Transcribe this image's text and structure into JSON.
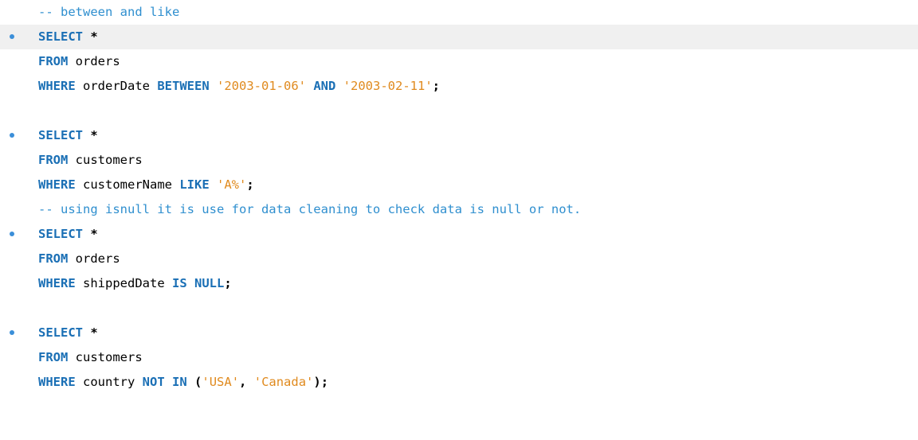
{
  "editor": {
    "language": "SQL",
    "colors": {
      "keyword": "#1a6fb5",
      "string": "#e08a1e",
      "comment": "#2f8fcf",
      "bullet": "#3b8fd9",
      "highlight": "#f0f0f0"
    },
    "lines": [
      {
        "bullet": false,
        "highlight": false,
        "tokens": [
          {
            "t": "cmt",
            "v": "-- between and like"
          }
        ]
      },
      {
        "bullet": true,
        "highlight": true,
        "tokens": [
          {
            "t": "kw",
            "v": "SELECT"
          },
          {
            "t": "plain",
            "v": " "
          },
          {
            "t": "op",
            "v": "*"
          }
        ]
      },
      {
        "bullet": false,
        "highlight": false,
        "tokens": [
          {
            "t": "kw",
            "v": "FROM"
          },
          {
            "t": "plain",
            "v": " orders"
          }
        ]
      },
      {
        "bullet": false,
        "highlight": false,
        "tokens": [
          {
            "t": "kw",
            "v": "WHERE"
          },
          {
            "t": "plain",
            "v": " orderDate "
          },
          {
            "t": "kw",
            "v": "BETWEEN"
          },
          {
            "t": "plain",
            "v": " "
          },
          {
            "t": "str",
            "v": "'2003-01-06'"
          },
          {
            "t": "plain",
            "v": " "
          },
          {
            "t": "kw",
            "v": "AND"
          },
          {
            "t": "plain",
            "v": " "
          },
          {
            "t": "str",
            "v": "'2003-02-11'"
          },
          {
            "t": "op",
            "v": ";"
          }
        ]
      },
      {
        "bullet": false,
        "highlight": false,
        "tokens": []
      },
      {
        "bullet": true,
        "highlight": false,
        "tokens": [
          {
            "t": "kw",
            "v": "SELECT"
          },
          {
            "t": "plain",
            "v": " "
          },
          {
            "t": "op",
            "v": "*"
          }
        ]
      },
      {
        "bullet": false,
        "highlight": false,
        "tokens": [
          {
            "t": "kw",
            "v": "FROM"
          },
          {
            "t": "plain",
            "v": " customers"
          }
        ]
      },
      {
        "bullet": false,
        "highlight": false,
        "tokens": [
          {
            "t": "kw",
            "v": "WHERE"
          },
          {
            "t": "plain",
            "v": " customerName "
          },
          {
            "t": "kw",
            "v": "LIKE"
          },
          {
            "t": "plain",
            "v": " "
          },
          {
            "t": "str",
            "v": "'A%'"
          },
          {
            "t": "op",
            "v": ";"
          }
        ]
      },
      {
        "bullet": false,
        "highlight": false,
        "tokens": [
          {
            "t": "cmt",
            "v": "-- using isnull it is use for data cleaning to check data is null or not."
          }
        ]
      },
      {
        "bullet": true,
        "highlight": false,
        "tokens": [
          {
            "t": "kw",
            "v": "SELECT"
          },
          {
            "t": "plain",
            "v": " "
          },
          {
            "t": "op",
            "v": "*"
          }
        ]
      },
      {
        "bullet": false,
        "highlight": false,
        "tokens": [
          {
            "t": "kw",
            "v": "FROM"
          },
          {
            "t": "plain",
            "v": " orders"
          }
        ]
      },
      {
        "bullet": false,
        "highlight": false,
        "tokens": [
          {
            "t": "kw",
            "v": "WHERE"
          },
          {
            "t": "plain",
            "v": " shippedDate "
          },
          {
            "t": "kw",
            "v": "IS"
          },
          {
            "t": "plain",
            "v": " "
          },
          {
            "t": "kw",
            "v": "NULL"
          },
          {
            "t": "op",
            "v": ";"
          }
        ]
      },
      {
        "bullet": false,
        "highlight": false,
        "tokens": []
      },
      {
        "bullet": true,
        "highlight": false,
        "tokens": [
          {
            "t": "kw",
            "v": "SELECT"
          },
          {
            "t": "plain",
            "v": " "
          },
          {
            "t": "op",
            "v": "*"
          }
        ]
      },
      {
        "bullet": false,
        "highlight": false,
        "tokens": [
          {
            "t": "kw",
            "v": "FROM"
          },
          {
            "t": "plain",
            "v": " customers"
          }
        ]
      },
      {
        "bullet": false,
        "highlight": false,
        "tokens": [
          {
            "t": "kw",
            "v": "WHERE"
          },
          {
            "t": "plain",
            "v": " country "
          },
          {
            "t": "kw",
            "v": "NOT"
          },
          {
            "t": "plain",
            "v": " "
          },
          {
            "t": "kw",
            "v": "IN"
          },
          {
            "t": "plain",
            "v": " "
          },
          {
            "t": "op",
            "v": "("
          },
          {
            "t": "str",
            "v": "'USA'"
          },
          {
            "t": "op",
            "v": ","
          },
          {
            "t": "plain",
            "v": " "
          },
          {
            "t": "str",
            "v": "'Canada'"
          },
          {
            "t": "op",
            "v": ");"
          }
        ]
      }
    ]
  }
}
